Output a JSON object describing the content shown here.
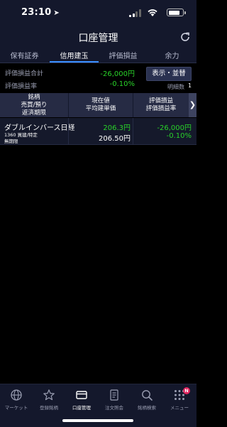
{
  "status_bar": {
    "time": "23:10"
  },
  "header": {
    "title": "口座管理"
  },
  "tabs": [
    {
      "label": "保有証券"
    },
    {
      "label": "信用建玉"
    },
    {
      "label": "評価損益"
    },
    {
      "label": "余力"
    }
  ],
  "summary": {
    "total_label": "評価損益合計",
    "total_value": "-26,000円",
    "rate_label": "評価損益率",
    "rate_value": "-0.10%",
    "display_button": "表示・並替",
    "count_label": "明細数",
    "count_value": "1"
  },
  "table": {
    "headers": {
      "col1_line1": "銘柄",
      "col1_line2": "売買/預り",
      "col1_line3": "返済期限",
      "col2_line1": "現在値",
      "col2_line2": "平均建単価",
      "col3_line1": "評価損益",
      "col3_line2": "評価損益率"
    },
    "rows": [
      {
        "name": "ダブルインバース日経",
        "code_side": "1360 買建/特定",
        "deadline": "無期限",
        "current_price": "206.3円",
        "avg_price": "206.50円",
        "pl": "-26,000円",
        "pl_rate": "-0.10%"
      }
    ]
  },
  "bottom_nav": [
    {
      "label": "マーケット",
      "icon": "globe-icon"
    },
    {
      "label": "登録銘柄",
      "icon": "star-icon"
    },
    {
      "label": "口座管理",
      "icon": "card-icon"
    },
    {
      "label": "注文照会",
      "icon": "document-icon"
    },
    {
      "label": "銘柄検索",
      "icon": "search-icon"
    },
    {
      "label": "メニュー",
      "icon": "grid-icon",
      "badge": "N"
    }
  ],
  "colors": {
    "accent": "#3a8fff",
    "positive_green": "#29d229",
    "header_bg": "#14182c",
    "badge_red": "#e0245e"
  }
}
